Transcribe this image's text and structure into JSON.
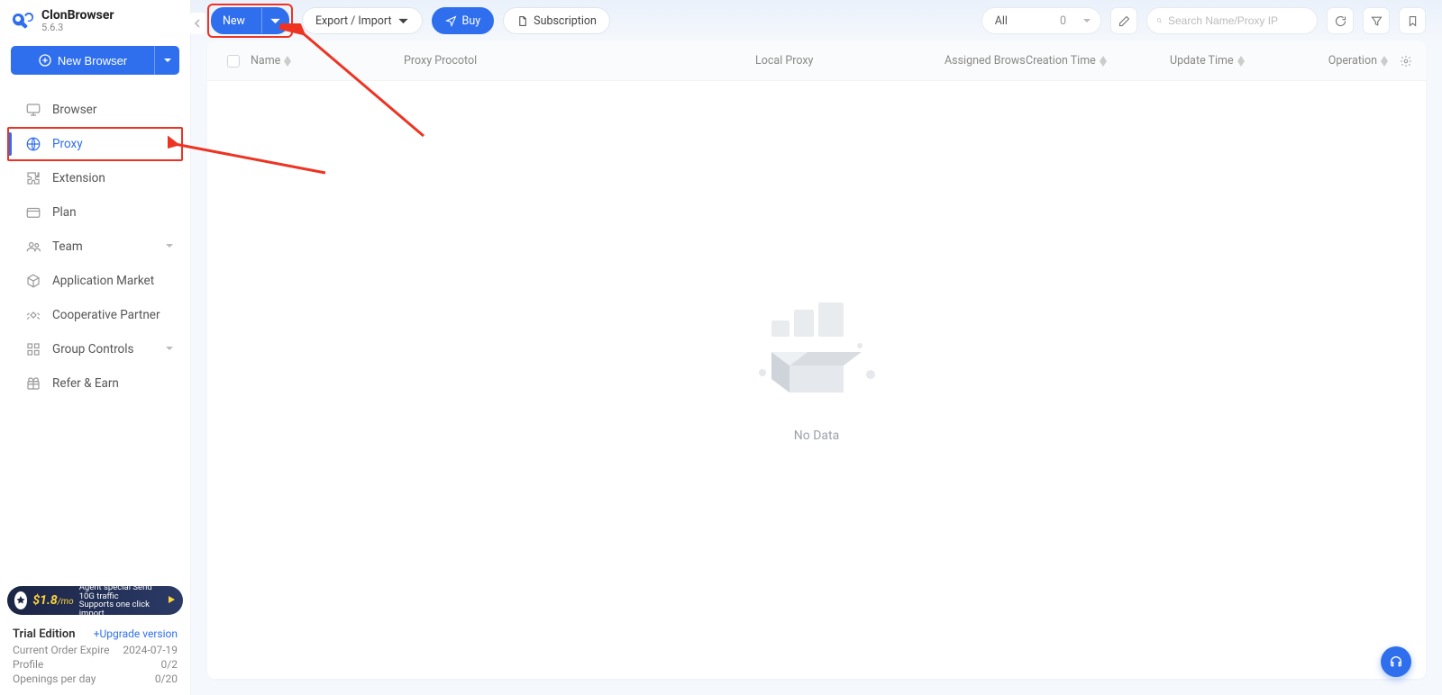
{
  "app": {
    "name": "ClonBrowser",
    "version": "5.6.3"
  },
  "sidebar": {
    "new_browser": "New Browser",
    "items": [
      {
        "label": "Browser",
        "icon": "monitor-icon"
      },
      {
        "label": "Proxy",
        "icon": "globe-icon",
        "active": true
      },
      {
        "label": "Extension",
        "icon": "puzzle-icon"
      },
      {
        "label": "Plan",
        "icon": "card-icon"
      },
      {
        "label": "Team",
        "icon": "users-icon",
        "expandable": true
      },
      {
        "label": "Application Market",
        "icon": "cube-icon"
      },
      {
        "label": "Cooperative Partner",
        "icon": "handshake-icon"
      },
      {
        "label": "Group Controls",
        "icon": "grid-icon",
        "expandable": true
      },
      {
        "label": "Refer & Earn",
        "icon": "gift-icon"
      }
    ]
  },
  "promo": {
    "price": "$1.8",
    "per": "/mo",
    "line1": "Agent special Send 10G traffic",
    "line2": "Supports one click import"
  },
  "footer": {
    "edition": "Trial Edition",
    "upgrade": "+Upgrade version",
    "rows": [
      {
        "label": "Current Order Expire",
        "value": "2024-07-19"
      },
      {
        "label": "Profile",
        "value": "0/2"
      },
      {
        "label": "Openings per day",
        "value": "0/20"
      }
    ]
  },
  "toolbar": {
    "new": "New",
    "export_import": "Export / Import",
    "buy": "Buy",
    "subscription": "Subscription",
    "filter_all": "All",
    "filter_count": "0",
    "search_placeholder": "Search Name/Proxy IP"
  },
  "table": {
    "columns": {
      "name": "Name",
      "protocol": "Proxy Procotol",
      "local": "Local Proxy",
      "assigned": "Assigned Brows",
      "created": "Creation Time",
      "updated": "Update Time",
      "operation": "Operation"
    },
    "empty": "No Data"
  }
}
